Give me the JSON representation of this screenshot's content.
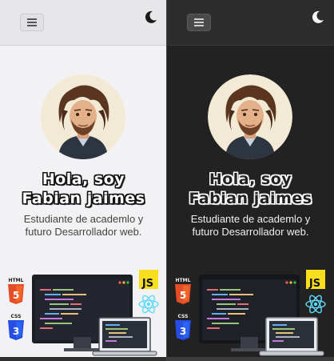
{
  "light": {
    "greeting_line1": "Hola, soy",
    "greeting_line2": "Fabian jaimes",
    "description_line1": "Estudiante de academlo y",
    "description_line2": "futuro Desarrollador web."
  },
  "dark": {
    "greeting_line1": "Hola, soy",
    "greeting_line2": "Fabian jaimes",
    "description_line1": "Estudiante de academlo y",
    "description_line2": "futuro Desarrollador web."
  },
  "tech_badges": {
    "html": "HTML",
    "css": "CSS",
    "js": "JS"
  },
  "icons": {
    "menu": "hamburger-menu-icon",
    "theme": "moon-icon"
  },
  "colors": {
    "light_bg": "#f2f2f4",
    "dark_bg": "#222222",
    "html_orange": "#e44d26",
    "css_blue": "#264de4",
    "js_yellow": "#f7df1e",
    "react_cyan": "#61dafb"
  }
}
